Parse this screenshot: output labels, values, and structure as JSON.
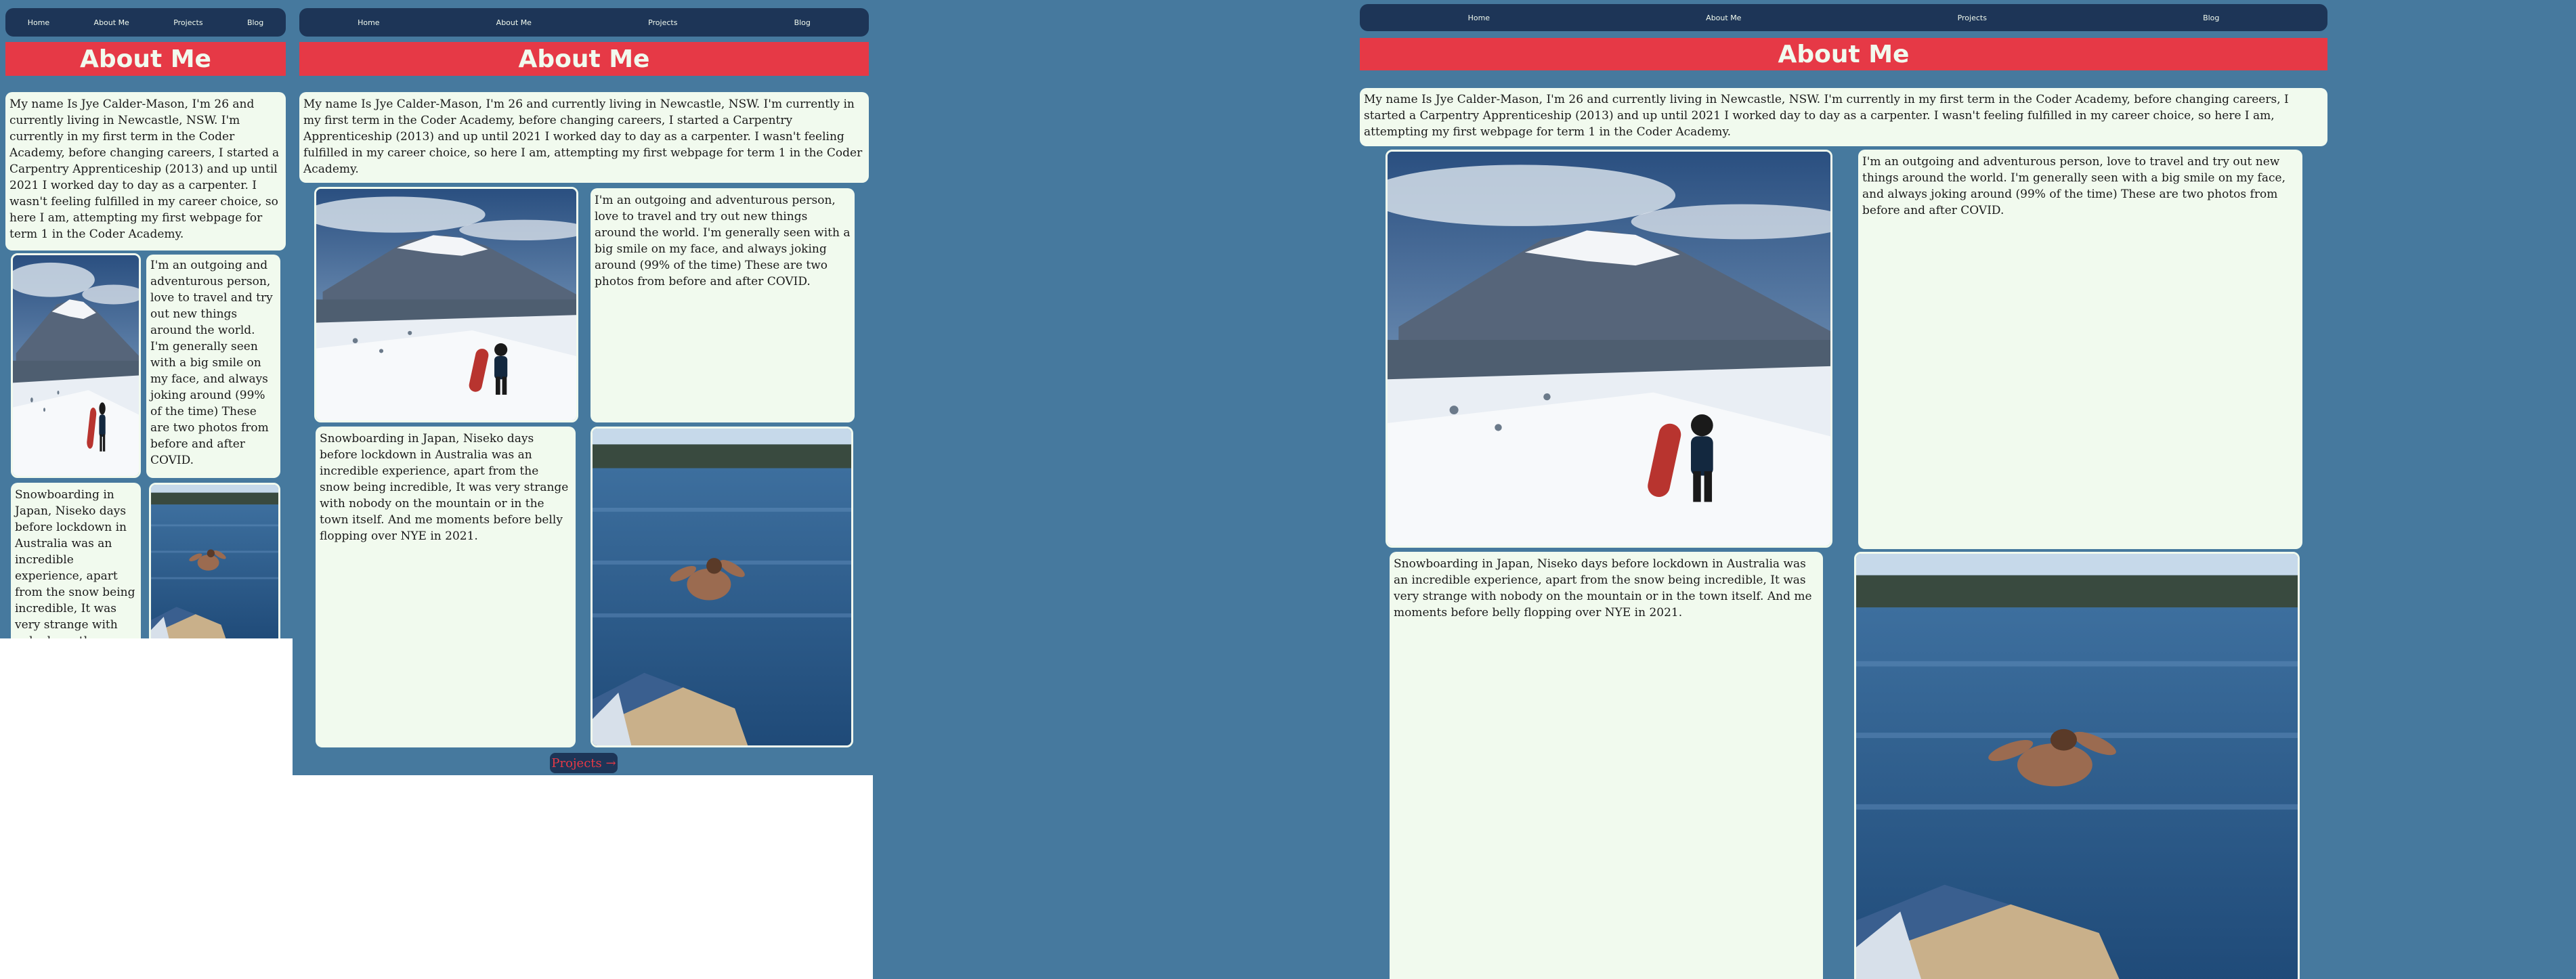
{
  "nav": {
    "items": [
      {
        "label": "Home"
      },
      {
        "label": "About Me"
      },
      {
        "label": "Projects"
      },
      {
        "label": "Blog"
      }
    ]
  },
  "page": {
    "title": "About Me",
    "intro": "My name Is Jye Calder-Mason, I'm 26 and currently living in Newcastle, NSW. I'm currently in my first term in the Coder Academy, before changing careers, I started a Carpentry Apprenticeship (2013) and up until 2021 I worked day to day as a carpenter. I wasn't feeling fulfilled in my career choice, so here I am, attempting my first webpage for term 1 in the Coder Academy.",
    "about": "I'm an outgoing and adventurous person, love to travel and try out new things around the world. I'm generally seen with a big smile on my face, and always joking around (99% of the time) These are two photos from before and after COVID.",
    "snow_caption": "Snowboarding in Japan, Niseko days before lockdown in Australia was an incredible experience, apart from the snow being incredible, It was very strange with nobody on the mountain or in the town itself. And me moments before belly flopping over NYE in 2021.",
    "next_link": "Projects →"
  },
  "colors": {
    "background": "#46799e",
    "nav": "#1d3557",
    "banner": "#e63946",
    "card": "#f1faee"
  },
  "images": {
    "snow": "snowboarder-mountain-photo",
    "lake": "lake-jump-photo"
  }
}
